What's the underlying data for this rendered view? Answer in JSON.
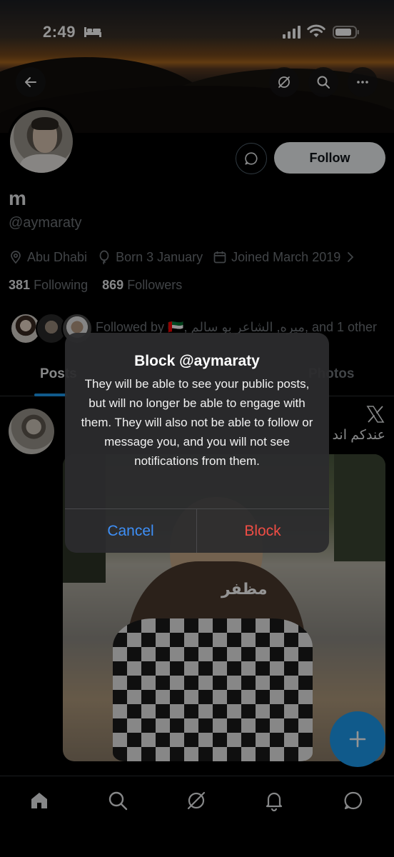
{
  "status_bar": {
    "time": "2:49"
  },
  "header": {
    "back_icon": "arrow-left-icon",
    "grok_icon": "grok-icon",
    "search_icon": "search-icon",
    "more_icon": "more-horizontal-icon"
  },
  "profile": {
    "name": "m",
    "handle": "@aymaraty",
    "follow_label": "Follow",
    "location": "Abu Dhabi",
    "birthday": "Born 3 January",
    "joined": "Joined March 2019",
    "following_count": "381",
    "following_label": "Following",
    "followers_count": "869",
    "followers_label": "Followers",
    "followed_by": "Followed by 🇦🇪, ميره, الشاعر بو سالم, and 1 other"
  },
  "tabs": [
    "Posts",
    "Photos"
  ],
  "post": {
    "text": "عندكم اند",
    "media_caption": "مظفر"
  },
  "dialog": {
    "title": "Block @aymaraty",
    "body": "They will be able to see your public posts, but will no longer be able to engage with them. They will also not be able to follow or message you, and you will not see notifications from them.",
    "cancel_label": "Cancel",
    "block_label": "Block"
  },
  "colors": {
    "accent": "#1d9bf0",
    "cancel": "#3e8ff7",
    "destructive": "#ef4d45",
    "background": "#000000"
  },
  "bottom_nav": [
    "home-icon",
    "search-icon",
    "grok-icon",
    "notifications-icon",
    "messages-icon"
  ]
}
